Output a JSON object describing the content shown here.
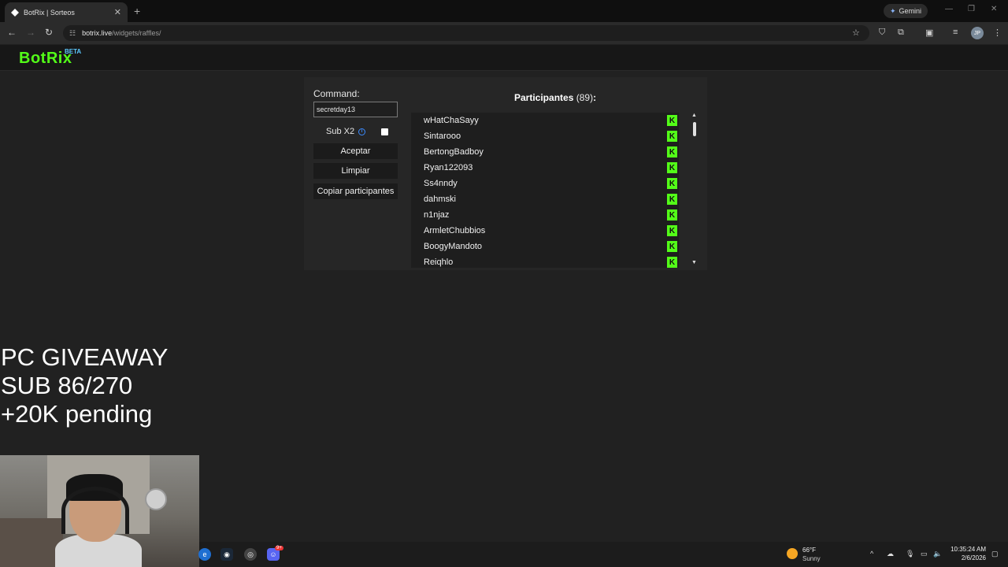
{
  "browser": {
    "tab_title": "BotRix | Sorteos",
    "tab_close": "✕",
    "new_tab": "+",
    "gemini_label": "Gemini",
    "url_host": "botrix.live",
    "url_path": "/widgets/raffles/",
    "profile_initials": "JP"
  },
  "site": {
    "logo": "BotRix",
    "badge": "BETA"
  },
  "raffle": {
    "command_label": "Command:",
    "command_value": "secretday13",
    "sub_label": "Sub X2",
    "sub_checked": false,
    "accept_label": "Aceptar",
    "clear_label": "Limpiar",
    "copy_label": "Copiar participantes",
    "participants_title": "Participantes",
    "participants_count": "(89)",
    "participants_colon": ":",
    "participants": [
      "wHatChaSayy",
      "Sintarooo",
      "BertongBadboy",
      "Ryan122093",
      "Ss4nndy",
      "dahmski",
      "n1njaz",
      "ArmletChubbios",
      "BoogyMandoto",
      "Reiqhlo"
    ]
  },
  "overlay": {
    "line1": "PC GIVEAWAY",
    "line2": "SUB 86/270",
    "line3": "+20K pending"
  },
  "taskbar": {
    "weather_temp": "66°F",
    "weather_cond": "Sunny",
    "time": "10:35:24 AM",
    "date": "2/6/2026",
    "discord_badge": "9+"
  },
  "colors": {
    "kick_green": "#53fc18",
    "beta_blue": "#5cc8ff"
  }
}
